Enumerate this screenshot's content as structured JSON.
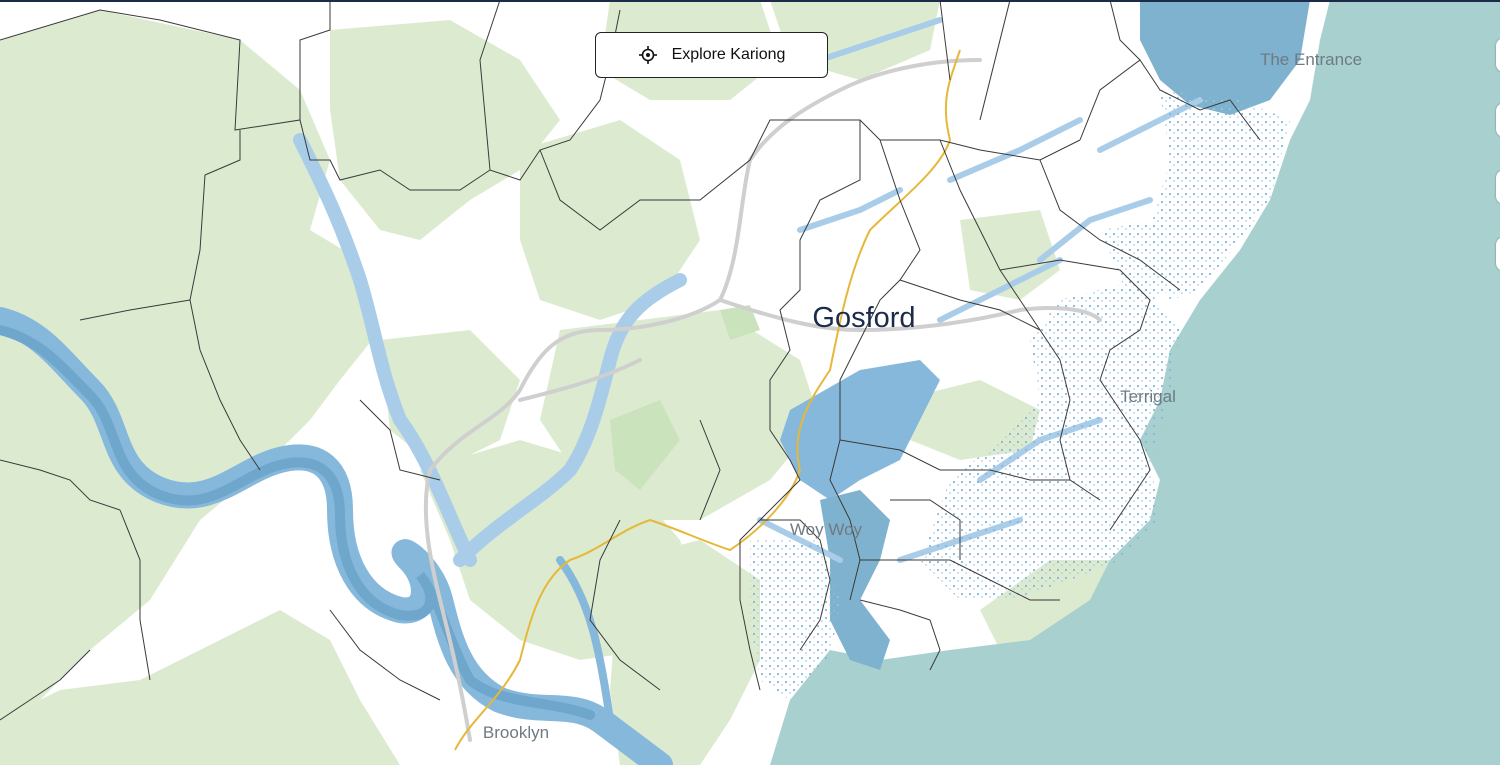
{
  "colors": {
    "ocean": "#a8d0cf",
    "land": "#ffffff",
    "reserve": "#dcebd0",
    "reserve_dark": "#cbe3bd",
    "flood_light": "#a9cde9",
    "flood_mid": "#86b8dc",
    "flood_dark": "#6fa6cc",
    "lake": "#7fb2cf",
    "boundary": "#3a3a3a",
    "road": "#cfcfcf",
    "rail": "#e6b83a",
    "label_major": "#1c2b4a",
    "label_minor": "#6f7a82"
  },
  "button": {
    "label": "Explore Kariong",
    "icon": "crosshair-icon"
  },
  "labels": {
    "gosford": "Gosford",
    "terrigal": "Terrigal",
    "the_entrance": "The Entrance",
    "woy_woy": "Woy Woy",
    "brooklyn": "Brooklyn"
  }
}
